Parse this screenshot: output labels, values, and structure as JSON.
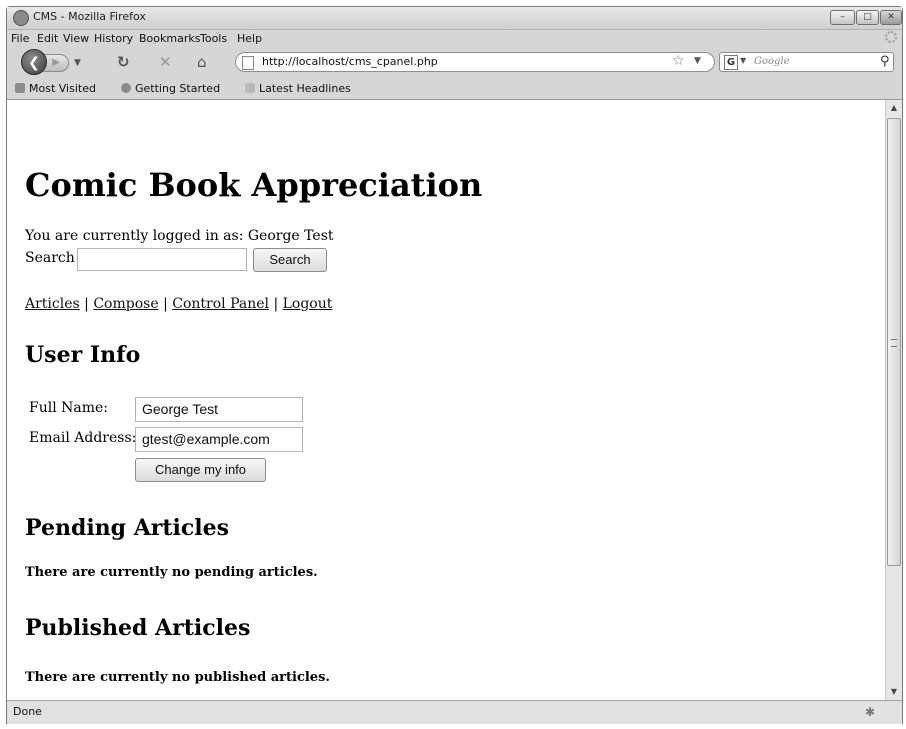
{
  "window": {
    "title": "CMS - Mozilla Firefox"
  },
  "menu": [
    "File",
    "Edit",
    "View",
    "History",
    "Bookmarks",
    "Tools",
    "Help"
  ],
  "toolbar": {
    "url": "http://localhost/cms_cpanel.php",
    "search_placeholder": "Google"
  },
  "bookmarks": [
    "Most Visited",
    "Getting Started",
    "Latest Headlines"
  ],
  "page": {
    "site_title": "Comic Book Appreciation",
    "logged_in": "You are currently logged in as: George Test",
    "search_label": "Search",
    "search_value": "",
    "search_button": "Search",
    "nav": [
      "Articles",
      "Compose",
      "Control Panel",
      "Logout"
    ],
    "nav_sep": "|",
    "user_info_heading": "User Info",
    "full_name_label": "Full Name:",
    "full_name_value": "George Test",
    "email_label": "Email Address:",
    "email_value": "gtest@example.com",
    "change_button": "Change my info",
    "pending_heading": "Pending Articles",
    "pending_message": "There are currently no pending articles.",
    "published_heading": "Published Articles",
    "published_message": "There are currently no published articles."
  },
  "status": {
    "text": "Done"
  }
}
